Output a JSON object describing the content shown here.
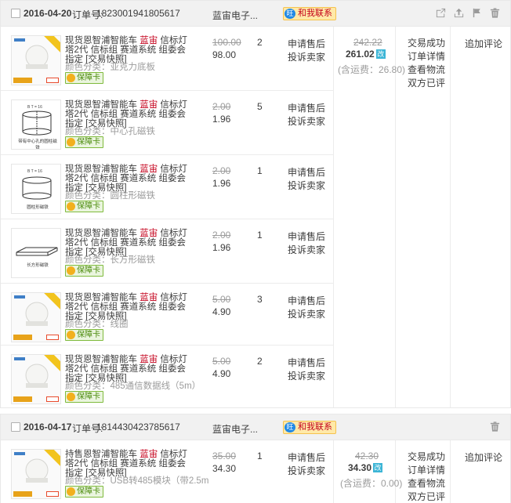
{
  "orders": [
    {
      "date": "2016-04-20",
      "order_no_label": "订单号:",
      "order_no": "1823001941805617",
      "shop": "蓝宙电子...",
      "contact": "和我联系",
      "header_icons": [
        "share-icon",
        "upload-icon",
        "flag-icon",
        "trash-icon"
      ],
      "summary": {
        "old_total": "242.22",
        "total": "261.02",
        "modified_badge": "改",
        "shipping": "(含运费：26.80)"
      },
      "status_links": [
        "交易成功",
        "订单详情",
        "查看物流",
        "双方已评"
      ],
      "review": "追加评论",
      "items": [
        {
          "title_pre": "现货恩智浦智能车 ",
          "title_hl": "蓝宙",
          "title_post": " 信标灯塔2代 信标组 赛道系统 组委会指定 [交易快照]",
          "spec": "颜色分类：亚克力底板",
          "badge": "保障卡",
          "old_price": "100.00",
          "price": "98.00",
          "qty": "2",
          "action1": "申请售后",
          "action2": "投诉卖家",
          "image": "lamp"
        },
        {
          "title_pre": "现货恩智浦智能车 ",
          "title_hl": "蓝宙",
          "title_post": " 信标灯塔2代 信标组 赛道系统 组委会指定 [交易快照]",
          "spec": "颜色分类：中心孔磁铁",
          "badge": "保障卡",
          "old_price": "2.00",
          "price": "1.96",
          "qty": "5",
          "action1": "申请售后",
          "action2": "投诉卖家",
          "image": "magnet-hole",
          "image_caption": "带有中心孔的圆柱磁铁"
        },
        {
          "title_pre": "现货恩智浦智能车 ",
          "title_hl": "蓝宙",
          "title_post": " 信标灯塔2代 信标组 赛道系统 组委会指定 [交易快照]",
          "spec": "颜色分类：圆柱形磁铁",
          "badge": "保障卡",
          "old_price": "2.00",
          "price": "1.96",
          "qty": "1",
          "action1": "申请售后",
          "action2": "投诉卖家",
          "image": "magnet-cyl",
          "image_caption": "圆柱形磁铁"
        },
        {
          "title_pre": "现货恩智浦智能车 ",
          "title_hl": "蓝宙",
          "title_post": " 信标灯塔2代 信标组 赛道系统 组委会指定 [交易快照]",
          "spec": "颜色分类：长方形磁铁",
          "badge": "保障卡",
          "old_price": "2.00",
          "price": "1.96",
          "qty": "1",
          "action1": "申请售后",
          "action2": "投诉卖家",
          "image": "magnet-rect",
          "image_caption": "长方形磁铁"
        },
        {
          "title_pre": "现货恩智浦智能车 ",
          "title_hl": "蓝宙",
          "title_post": " 信标灯塔2代 信标组 赛道系统 组委会指定 [交易快照]",
          "spec": "颜色分类：线圈",
          "badge": "保障卡",
          "old_price": "5.00",
          "price": "4.90",
          "qty": "3",
          "action1": "申请售后",
          "action2": "投诉卖家",
          "image": "lamp"
        },
        {
          "title_pre": "现货恩智浦智能车 ",
          "title_hl": "蓝宙",
          "title_post": " 信标灯塔2代 信标组 赛道系统 组委会指定 [交易快照]",
          "spec": "颜色分类：485通信数据线（5m）",
          "badge": "保障卡",
          "old_price": "5.00",
          "price": "4.90",
          "qty": "2",
          "action1": "申请售后",
          "action2": "投诉卖家",
          "image": "lamp"
        }
      ]
    },
    {
      "date": "2016-04-17",
      "order_no_label": "订单号:",
      "order_no": "1814430423785617",
      "shop": "蓝宙电子...",
      "contact": "和我联系",
      "header_icons": [
        "trash-icon"
      ],
      "summary": {
        "old_total": "42.30",
        "total": "34.30",
        "modified_badge": "改",
        "shipping": "(含运费：0.00)"
      },
      "status_links": [
        "交易成功",
        "订单详情",
        "查看物流",
        "双方已评"
      ],
      "review": "追加评论",
      "items": [
        {
          "title_pre": "持售恩智浦智能车 ",
          "title_hl": "蓝宙",
          "title_post": " 信标灯塔2代 信标组 赛道系统 组委会指定 [交易快照]",
          "spec": "颜色分类：USB转485模块（带2.5m",
          "badge": "保障卡",
          "old_price": "35.00",
          "price": "34.30",
          "qty": "1",
          "action1": "申请售后",
          "action2": "投诉卖家",
          "image": "lamp"
        }
      ]
    }
  ],
  "colors": {
    "highlight": "#c4001b",
    "header_bg": "#f1f1f1",
    "badge_green": "#4a8a0b",
    "modified_blue": "#3cb5d6"
  }
}
